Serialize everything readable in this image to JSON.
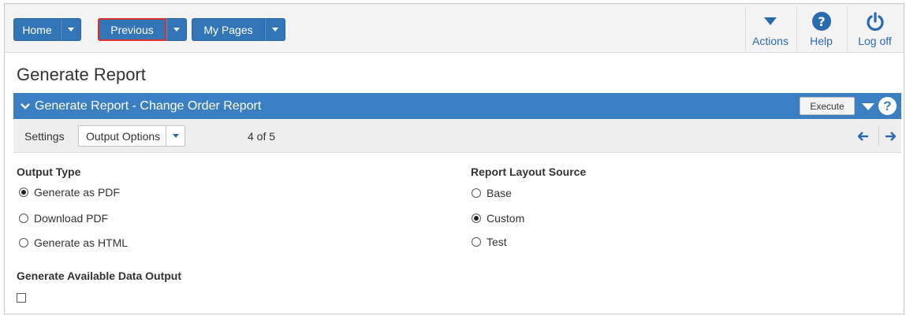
{
  "nav": {
    "home_label": "Home",
    "previous_label": "Previous",
    "mypages_label": "My Pages"
  },
  "top_actions": {
    "actions_label": "Actions",
    "help_label": "Help",
    "logoff_label": "Log off"
  },
  "page": {
    "title": "Generate Report"
  },
  "panel": {
    "title": "Generate Report - Change Order Report",
    "execute_label": "Execute",
    "help_glyph": "?"
  },
  "settings": {
    "label": "Settings",
    "selected_option": "Output Options",
    "page_count": "4 of 5"
  },
  "output_type": {
    "heading": "Output Type",
    "options": [
      {
        "label": "Generate as PDF",
        "checked": true
      },
      {
        "label": "Download PDF",
        "checked": false
      },
      {
        "label": "Generate as HTML",
        "checked": false
      }
    ]
  },
  "layout_source": {
    "heading": "Report Layout Source",
    "options": [
      {
        "label": "Base",
        "checked": false
      },
      {
        "label": "Custom",
        "checked": true
      },
      {
        "label": "Test",
        "checked": false
      }
    ]
  },
  "data_output": {
    "heading": "Generate Available Data Output",
    "checked": false
  },
  "colors": {
    "nav_blue": "#3276b8",
    "panel_blue": "#3a7fc1",
    "link_blue": "#2a6bb0",
    "active_outline": "#d9322b"
  }
}
